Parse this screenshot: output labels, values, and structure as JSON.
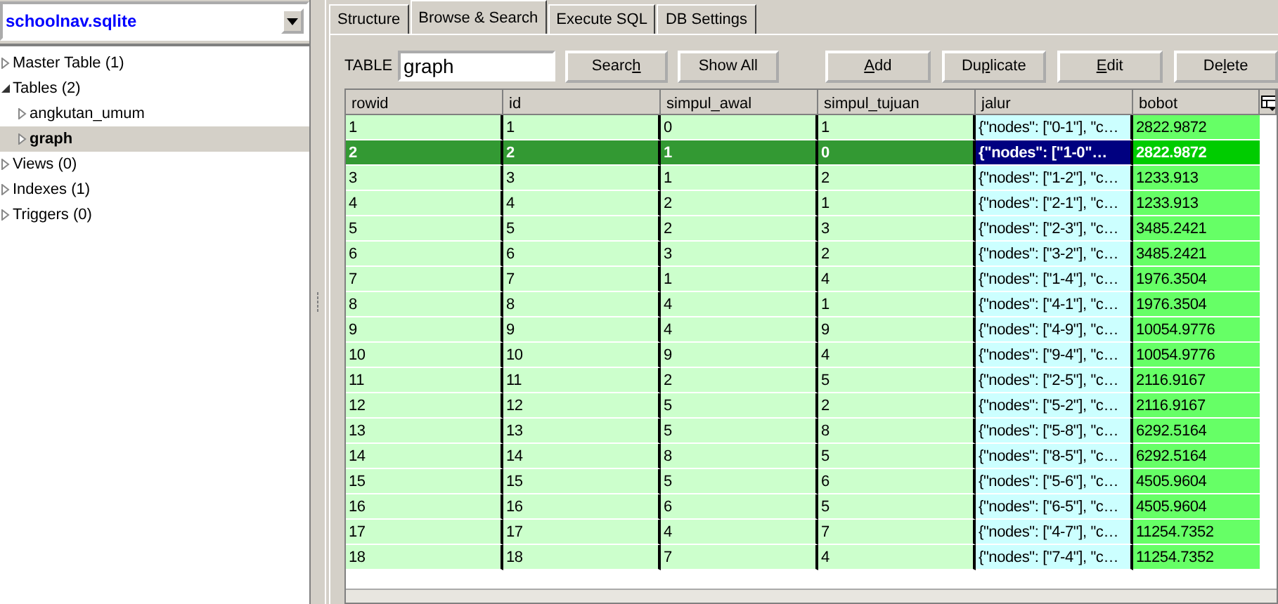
{
  "database": {
    "name": "schoolnav.sqlite"
  },
  "tree": [
    {
      "label": "Master Table (1)",
      "expanded": false,
      "selected": false
    },
    {
      "label": "Tables (2)",
      "expanded": true,
      "selected": false,
      "children": [
        {
          "label": "angkutan_umum",
          "expanded": false,
          "selected": false
        },
        {
          "label": "graph",
          "expanded": false,
          "selected": true
        }
      ]
    },
    {
      "label": "Views (0)",
      "expanded": false,
      "selected": false
    },
    {
      "label": "Indexes (1)",
      "expanded": false,
      "selected": false
    },
    {
      "label": "Triggers (0)",
      "expanded": false,
      "selected": false
    }
  ],
  "tabs": [
    {
      "label": "Structure",
      "selected": false
    },
    {
      "label": "Browse & Search",
      "selected": true
    },
    {
      "label": "Execute SQL",
      "selected": false
    },
    {
      "label": "DB Settings",
      "selected": false
    }
  ],
  "table_field": {
    "label": "TABLE",
    "value": "graph"
  },
  "search_buttons": [
    {
      "before": "Searc",
      "key": "h"
    },
    {
      "before": "Show All"
    }
  ],
  "record_buttons": [
    {
      "key": "A",
      "after": "dd"
    },
    {
      "before": "Du",
      "key": "p",
      "after": "licate"
    },
    {
      "key": "E",
      "after": "dit"
    },
    {
      "before": "De",
      "key": "l",
      "after": "ete"
    }
  ],
  "table": {
    "columns": [
      "rowid",
      "id",
      "simpul_awal",
      "simpul_tujuan",
      "jalur",
      "bobot"
    ],
    "rows": [
      {
        "cells": [
          "1",
          "1",
          "0",
          "1",
          "{\"nodes\": [\"0-1\"], \"c…",
          "2822.9872"
        ],
        "selected": false
      },
      {
        "cells": [
          "2",
          "2",
          "1",
          "0",
          "{\"nodes\": [\"1-0\"…",
          "2822.9872"
        ],
        "selected": true
      },
      {
        "cells": [
          "3",
          "3",
          "1",
          "2",
          "{\"nodes\": [\"1-2\"], \"c…",
          "1233.913"
        ],
        "selected": false
      },
      {
        "cells": [
          "4",
          "4",
          "2",
          "1",
          "{\"nodes\": [\"2-1\"], \"c…",
          "1233.913"
        ],
        "selected": false
      },
      {
        "cells": [
          "5",
          "5",
          "2",
          "3",
          "{\"nodes\": [\"2-3\"], \"c…",
          "3485.2421"
        ],
        "selected": false
      },
      {
        "cells": [
          "6",
          "6",
          "3",
          "2",
          "{\"nodes\": [\"3-2\"], \"c…",
          "3485.2421"
        ],
        "selected": false
      },
      {
        "cells": [
          "7",
          "7",
          "1",
          "4",
          "{\"nodes\": [\"1-4\"], \"c…",
          "1976.3504"
        ],
        "selected": false
      },
      {
        "cells": [
          "8",
          "8",
          "4",
          "1",
          "{\"nodes\": [\"4-1\"], \"c…",
          "1976.3504"
        ],
        "selected": false
      },
      {
        "cells": [
          "9",
          "9",
          "4",
          "9",
          "{\"nodes\": [\"4-9\"], \"c…",
          "10054.9776"
        ],
        "selected": false
      },
      {
        "cells": [
          "10",
          "10",
          "9",
          "4",
          "{\"nodes\": [\"9-4\"], \"c…",
          "10054.9776"
        ],
        "selected": false
      },
      {
        "cells": [
          "11",
          "11",
          "2",
          "5",
          "{\"nodes\": [\"2-5\"], \"c…",
          "2116.9167"
        ],
        "selected": false
      },
      {
        "cells": [
          "12",
          "12",
          "5",
          "2",
          "{\"nodes\": [\"5-2\"], \"c…",
          "2116.9167"
        ],
        "selected": false
      },
      {
        "cells": [
          "13",
          "13",
          "5",
          "8",
          "{\"nodes\": [\"5-8\"], \"c…",
          "6292.5164"
        ],
        "selected": false
      },
      {
        "cells": [
          "14",
          "14",
          "8",
          "5",
          "{\"nodes\": [\"8-5\"], \"c…",
          "6292.5164"
        ],
        "selected": false
      },
      {
        "cells": [
          "15",
          "15",
          "5",
          "6",
          "{\"nodes\": [\"5-6\"], \"c…",
          "4505.9604"
        ],
        "selected": false
      },
      {
        "cells": [
          "16",
          "16",
          "6",
          "5",
          "{\"nodes\": [\"6-5\"], \"c…",
          "4505.9604"
        ],
        "selected": false
      },
      {
        "cells": [
          "17",
          "17",
          "4",
          "7",
          "{\"nodes\": [\"4-7\"], \"c…",
          "11254.7352"
        ],
        "selected": false
      },
      {
        "cells": [
          "18",
          "18",
          "7",
          "4",
          "{\"nodes\": [\"7-4\"], \"c…",
          "11254.7352"
        ],
        "selected": false
      }
    ]
  }
}
